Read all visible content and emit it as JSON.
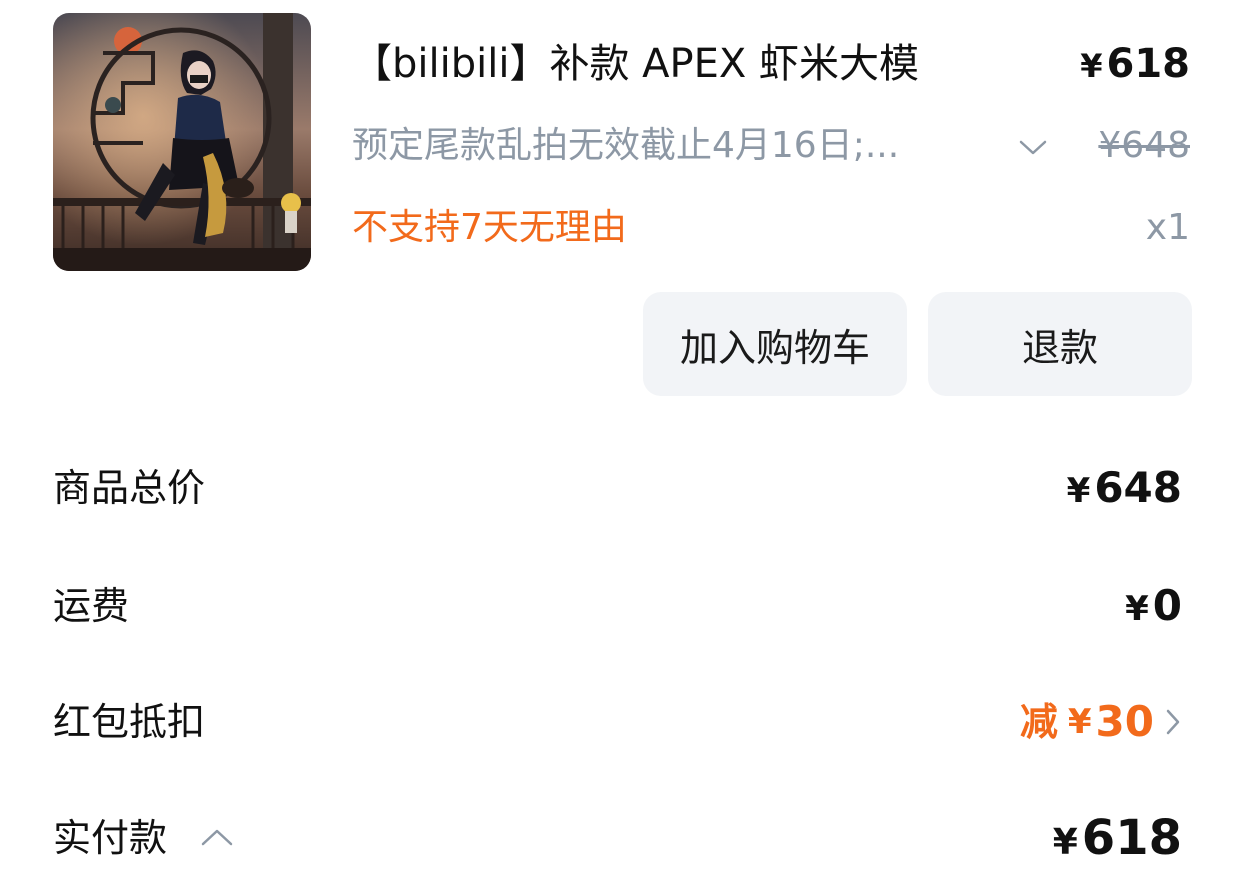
{
  "product": {
    "image_icon": "product-figure-image",
    "title": "【bilibili】补款 APEX 虾米大模",
    "price_symbol": "¥",
    "price": "618",
    "spec": "预定尾款乱拍无效截止4月16日;...",
    "original_price": "¥648",
    "policy": "不支持7天无理由",
    "quantity": "x1",
    "colors": {
      "policy": "#f26a1b",
      "muted": "#8d98a5"
    }
  },
  "actions": {
    "add_to_cart": "加入购物车",
    "refund": "退款"
  },
  "summary": {
    "goods_total": {
      "label": "商品总价",
      "symbol": "¥",
      "value": "648"
    },
    "shipping": {
      "label": "运费",
      "symbol": "¥",
      "value": "0"
    },
    "red_packet": {
      "label": "红包抵扣",
      "prefix": "减",
      "symbol": "¥",
      "value": "30"
    },
    "paid": {
      "label": "实付款",
      "symbol": "¥",
      "value": "618"
    }
  },
  "accent_color": "#f26a1b"
}
